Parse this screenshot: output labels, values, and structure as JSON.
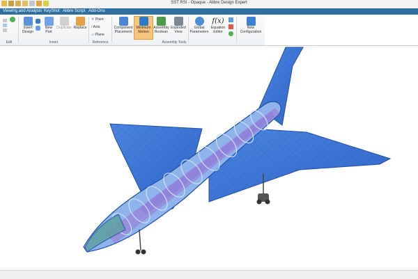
{
  "window": {
    "title": "SST RSI - Opaque - Alibre Design Expert"
  },
  "menu": {
    "items": [
      "Viewing and Analysis",
      "KeyShot",
      "Alibre Script",
      "Add-Ons"
    ]
  },
  "ribbon": {
    "edit_group": "Edit",
    "insert_group": "Insert",
    "reference_group": "Reference",
    "assembly_tools_group": "Assembly Tools",
    "buttons": {
      "insert_design": "Insert Design",
      "new_part": "New Part",
      "duplicate": "Duplicate",
      "replace": "Replace",
      "point": "Point",
      "axis": "Axis",
      "plane": "Plane",
      "component_placement": "Component Placement",
      "minimum_motion": "Minimum Motion",
      "assembly_boolean": "Assembly Boolean",
      "exploded_view": "Exploded View",
      "global_parameters": "Global Parameters",
      "equation_editor": "Equation Editor",
      "new_configuration": "New Configuration",
      "equation_symbol": "f(x)"
    }
  },
  "colors": {
    "menubar": "#2f6f9f",
    "aircraft_skin": "#3f78d6",
    "aircraft_edge": "#1e4fa8",
    "fuselage_ribs": "#8a78d8",
    "active_button": "#f6c47a"
  },
  "icons": {
    "insert_design": "insert-design-icon",
    "new_part": "new-part-icon",
    "duplicate": "duplicate-icon",
    "replace": "replace-icon",
    "component_placement": "component-placement-icon",
    "minimum_motion": "minimum-motion-icon",
    "assembly_boolean": "assembly-boolean-icon",
    "exploded_view": "exploded-view-icon",
    "global_parameters": "global-parameters-icon",
    "equation_editor": "equation-editor-icon",
    "new_configuration": "new-configuration-icon"
  }
}
